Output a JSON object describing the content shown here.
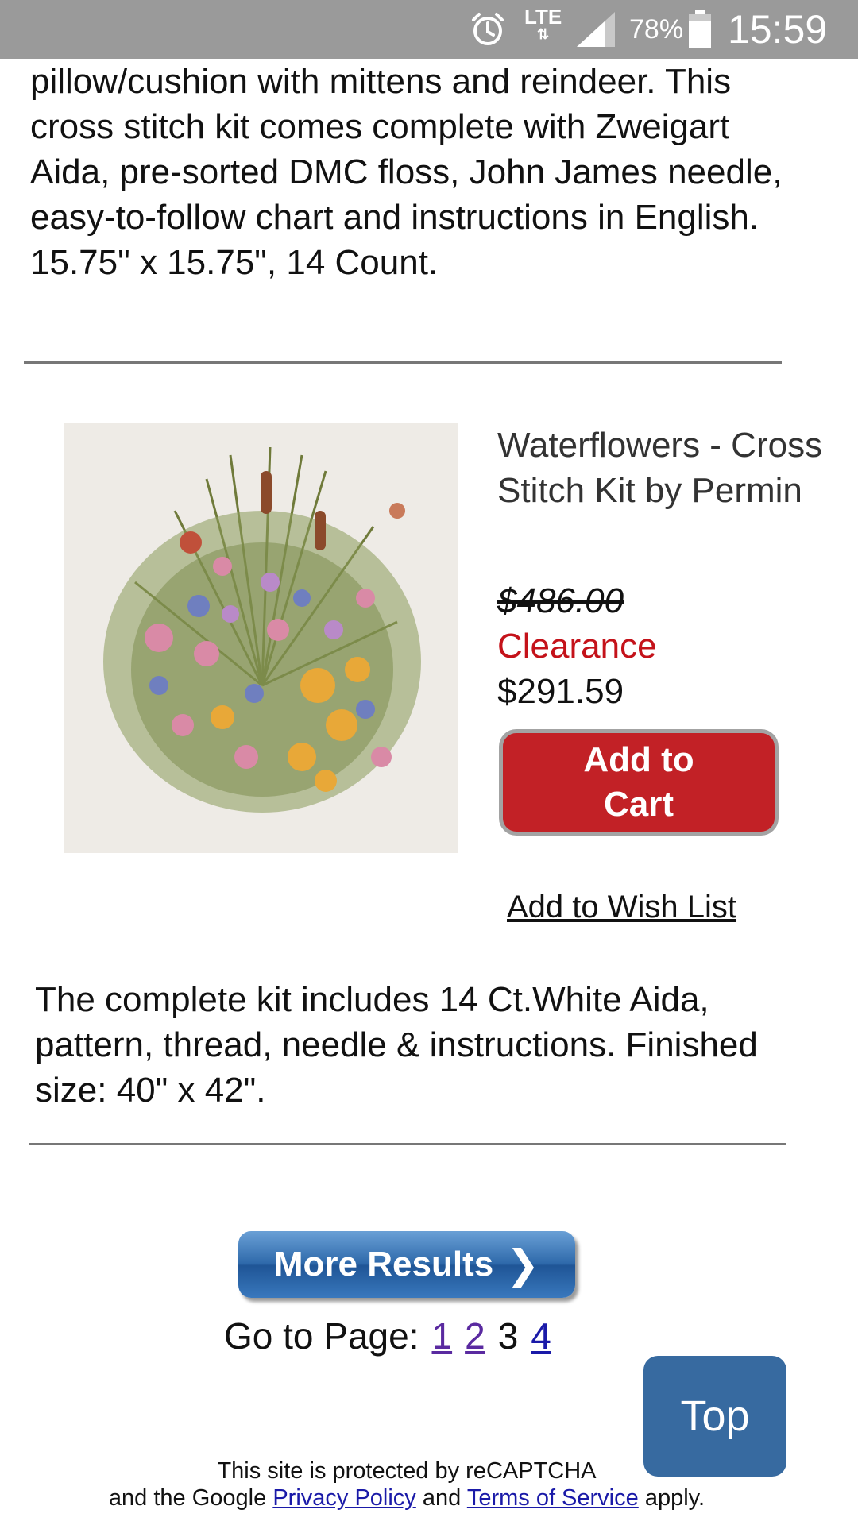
{
  "status_bar": {
    "network": "LTE",
    "data_arrows": "⇅",
    "battery_percent": "78%",
    "time": "15:59",
    "icons": [
      "alarm-icon",
      "signal-icon",
      "battery-icon"
    ]
  },
  "previous_item": {
    "description": "pillow/cushion with mittens and reindeer. This cross stitch kit comes complete with Zweigart Aida, pre-sorted DMC floss, John James needle, easy-to-follow chart and instructions in English. 15.75\" x 15.75\", 14 Count."
  },
  "product": {
    "title": "Waterflowers - Cross Stitch Kit by Permin",
    "original_price": "$486.00",
    "price_label": "Clearance",
    "price": "$291.59",
    "add_to_cart": "Add to Cart",
    "wishlist": "Add to Wish List",
    "description": "The complete kit includes 14 Ct.White Aida, pattern, thread, needle & instructions. Finished size: 40\" x 42\"."
  },
  "pagination": {
    "more_results": "More Results",
    "go_to_page": "Go to Page:",
    "pages": [
      "1",
      "2",
      "3",
      "4"
    ],
    "current_page": "3"
  },
  "top_button": "Top",
  "recaptcha": {
    "line1": "This site is protected by reCAPTCHA",
    "line2_prefix": "and the Google",
    "privacy": "Privacy Policy",
    "and": "and",
    "terms": "Terms of Service",
    "suffix": "apply."
  },
  "colors": {
    "status_bar": "#9a9a9a",
    "clearance": "#c4121a",
    "cart_button": "#c22126",
    "top_button": "#376aa0",
    "link": "#1a1aa8"
  }
}
